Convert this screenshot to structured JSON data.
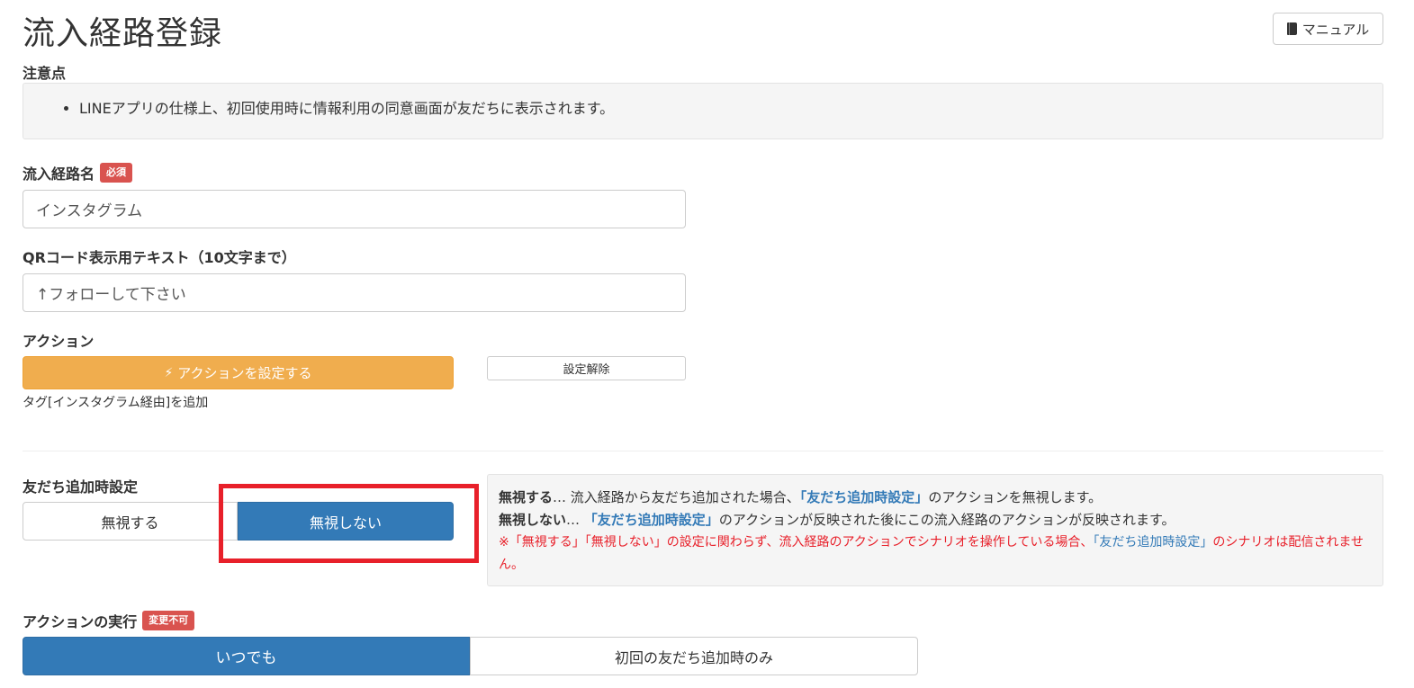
{
  "page": {
    "title": "流入経路登録"
  },
  "header": {
    "manual_label": "マニュアル"
  },
  "notice": {
    "label": "注意点",
    "items": [
      "LINEアプリの仕様上、初回使用時に情報利用の同意画面が友だちに表示されます。"
    ]
  },
  "route_name": {
    "label": "流入経路名",
    "badge": "必須",
    "value": "インスタグラム"
  },
  "qr_text": {
    "label": "QRコード表示用テキスト（10文字まで）",
    "value": "↑フォローして下さい"
  },
  "action": {
    "label": "アクション",
    "set_label": "アクションを設定する",
    "clear_label": "設定解除",
    "note": "タグ[インスタグラム経由]を追加"
  },
  "friend_add": {
    "label": "友だち追加時設定",
    "options": [
      "無視する",
      "無視しない"
    ],
    "selected": "無視しない",
    "info": {
      "line1_term": "無視する",
      "line1_sep": "… 流入経路から友だち追加された場合、",
      "line1_link": "「友だち追加時設定」",
      "line1_tail": "のアクションを無視します。",
      "line2_term": "無視しない",
      "line2_sep": "… ",
      "line2_link": "「友だち追加時設定」",
      "line2_tail": "のアクションが反映された後にこの流入経路のアクションが反映されます。",
      "warn_head": "※「無視する」「無視しない」の設定に関わらず、流入経路のアクションでシナリオを操作している場合、",
      "warn_link": "「友だち追加時設定」",
      "warn_tail": "のシナリオは配信されません。"
    }
  },
  "execution": {
    "label": "アクションの実行",
    "badge": "変更不可",
    "options": [
      "いつでも",
      "初回の友だち追加時のみ"
    ],
    "selected": "いつでも"
  },
  "colors": {
    "primary": "#337ab7",
    "warning": "#f0ad4e",
    "danger": "#d9534f",
    "highlight": "#e8202a"
  },
  "icons": {
    "manual": "book-icon",
    "action": "bolt-icon"
  }
}
